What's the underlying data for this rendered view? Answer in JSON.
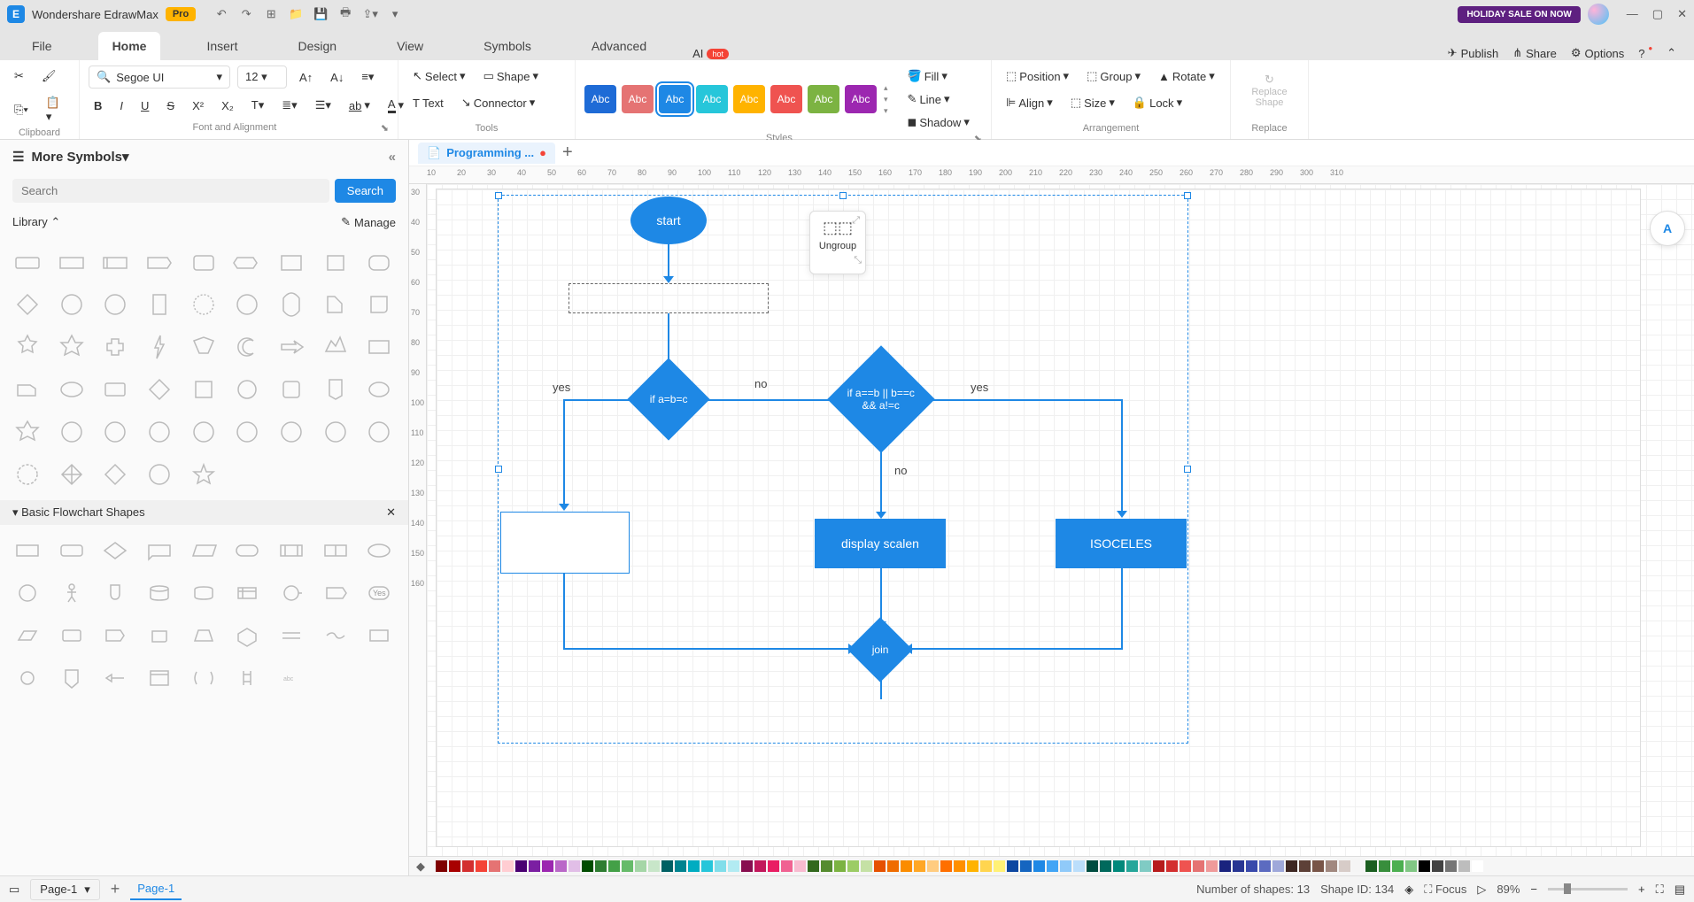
{
  "app": {
    "title": "Wondershare EdrawMax",
    "edition": "Pro",
    "holiday_text": "HOLIDAY SALE ON NOW"
  },
  "menu": {
    "tabs": [
      "File",
      "Home",
      "Insert",
      "Design",
      "View",
      "Symbols",
      "Advanced"
    ],
    "active": "Home",
    "ai_label": "AI",
    "hot_badge": "hot",
    "publish": "Publish",
    "share": "Share",
    "options": "Options"
  },
  "ribbon": {
    "clipboard_label": "Clipboard",
    "font_label": "Font and Alignment",
    "tools_label": "Tools",
    "styles_label": "Styles",
    "arrangement_label": "Arrangement",
    "replace_label": "Replace",
    "font_name": "Segoe UI",
    "font_size": "12",
    "select": "Select",
    "text": "Text",
    "shape": "Shape",
    "connector": "Connector",
    "swatch_text": "Abc",
    "swatch_colors": [
      "#1e6bd6",
      "#e57373",
      "#1e88e5",
      "#26c6da",
      "#ffb300",
      "#ef5350",
      "#7cb342",
      "#9c27b0"
    ],
    "swatch_selected": 2,
    "fill": "Fill",
    "line": "Line",
    "shadow": "Shadow",
    "position": "Position",
    "align": "Align",
    "group": "Group",
    "size": "Size",
    "rotate": "Rotate",
    "lock": "Lock",
    "replace_shape_l1": "Replace",
    "replace_shape_l2": "Shape"
  },
  "leftpanel": {
    "title": "More Symbols",
    "search_placeholder": "Search",
    "search_button": "Search",
    "library": "Library",
    "manage": "Manage",
    "section": "Basic Flowchart Shapes",
    "yes_shape": "Yes"
  },
  "doc": {
    "tab_name": "Programming ...",
    "dirty": "●",
    "ruler_h": [
      "10",
      "20",
      "30",
      "40",
      "50",
      "60",
      "70",
      "80",
      "90",
      "100",
      "110",
      "120",
      "130",
      "140",
      "150",
      "160",
      "170",
      "180",
      "190",
      "200",
      "210",
      "220",
      "230",
      "240",
      "250",
      "260",
      "270",
      "280",
      "290",
      "300",
      "310"
    ],
    "ruler_v": [
      "30",
      "40",
      "50",
      "60",
      "70",
      "80",
      "90",
      "100",
      "110",
      "120",
      "130",
      "140",
      "150",
      "160"
    ]
  },
  "flow": {
    "start": "start",
    "cond1": "if a=b=c",
    "cond2": "if a==b || b==c && a!=c",
    "scalen": "display scalen",
    "isoceles": "ISOCELES",
    "join": "join",
    "yes": "yes",
    "no": "no",
    "no2": "no"
  },
  "float": {
    "ungroup": "Ungroup"
  },
  "colorstrip": [
    "#7f0000",
    "#a80000",
    "#d32f2f",
    "#f44336",
    "#e57373",
    "#ffcdd2",
    "#4a0072",
    "#7b1fa2",
    "#9c27b0",
    "#ba68c8",
    "#e1bee7",
    "#004d00",
    "#2e7d32",
    "#43a047",
    "#66bb6a",
    "#a5d6a7",
    "#c8e6c9",
    "#006064",
    "#00838f",
    "#00acc1",
    "#26c6da",
    "#80deea",
    "#b2ebf2",
    "#880e4f",
    "#c2185b",
    "#e91e63",
    "#f06292",
    "#f8bbd0",
    "#33691e",
    "#558b2f",
    "#7cb342",
    "#9ccc65",
    "#c5e1a5",
    "#e65100",
    "#ef6c00",
    "#fb8c00",
    "#ffa726",
    "#ffcc80",
    "#ff6f00",
    "#ff8f00",
    "#ffb300",
    "#ffd54f",
    "#fff176",
    "#0d47a1",
    "#1565c0",
    "#1e88e5",
    "#42a5f5",
    "#90caf9",
    "#bbdefb",
    "#004d40",
    "#00695c",
    "#00897b",
    "#26a69a",
    "#80cbc4",
    "#b71c1c",
    "#d32f2f",
    "#ef5350",
    "#e57373",
    "#ef9a9a",
    "#1a237e",
    "#283593",
    "#3949ab",
    "#5c6bc0",
    "#9fa8da",
    "#3e2723",
    "#5d4037",
    "#795548",
    "#a1887f",
    "#d7ccc8",
    "#f5f5f5",
    "#1b5e20",
    "#388e3c",
    "#4caf50",
    "#81c784",
    "#000000",
    "#424242",
    "#757575",
    "#bdbdbd",
    "#ffffff"
  ],
  "status": {
    "page_dropdown": "Page-1",
    "page_active": "Page-1",
    "shape_count_label": "Number of shapes:",
    "shape_count": "13",
    "shape_id_label": "Shape ID:",
    "shape_id": "134",
    "focus": "Focus",
    "zoom": "89%"
  }
}
